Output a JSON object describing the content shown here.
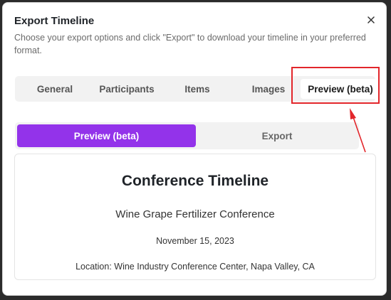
{
  "dialog": {
    "title": "Export Timeline",
    "subtitle": "Choose your export options and click \"Export\" to download your timeline in your preferred format.",
    "close_icon": "close-icon"
  },
  "tabs": [
    {
      "label": "General"
    },
    {
      "label": "Participants"
    },
    {
      "label": "Items"
    },
    {
      "label": "Images"
    },
    {
      "label": "Preview (beta)"
    }
  ],
  "active_tab": "Preview (beta)",
  "subtabs": [
    {
      "label": "Preview (beta)"
    },
    {
      "label": "Export"
    }
  ],
  "active_subtab": "Preview (beta)",
  "preview": {
    "title": "Conference Timeline",
    "subtitle": "Wine Grape Fertilizer Conference",
    "date": "November 15, 2023",
    "location": "Location: Wine Industry Conference Center, Napa Valley, CA"
  },
  "colors": {
    "accent": "#9333ea",
    "annotation": "#e2262b"
  }
}
